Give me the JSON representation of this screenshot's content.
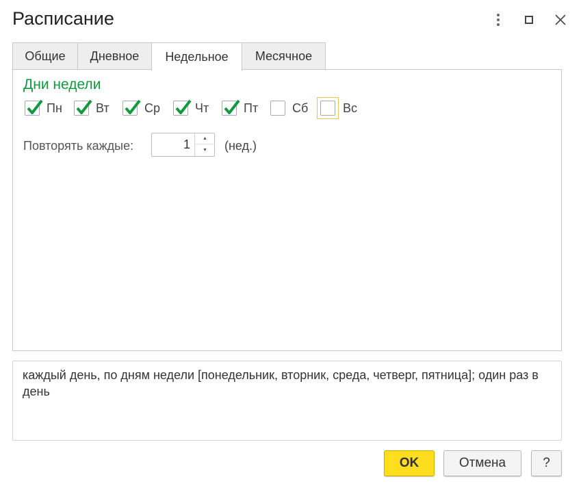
{
  "window": {
    "title": "Расписание",
    "menu_icon": "more-vertical-icon",
    "maximize_icon": "maximize-icon",
    "close_icon": "close-icon"
  },
  "tabs": [
    {
      "label": "Общие",
      "active": false
    },
    {
      "label": "Дневное",
      "active": false
    },
    {
      "label": "Недельное",
      "active": true
    },
    {
      "label": "Месячное",
      "active": false
    }
  ],
  "weekly": {
    "group_title": "Дни недели",
    "accent_color": "#0f9a3e",
    "days": [
      {
        "label": "Пн",
        "checked": true
      },
      {
        "label": "Вт",
        "checked": true
      },
      {
        "label": "Ср",
        "checked": true
      },
      {
        "label": "Чт",
        "checked": true
      },
      {
        "label": "Пт",
        "checked": true
      },
      {
        "label": "Сб",
        "checked": false
      },
      {
        "label": "Вс",
        "checked": false,
        "focused": true
      }
    ],
    "repeat_label": "Повторять каждые:",
    "repeat_value": "1",
    "repeat_unit": "(нед.)"
  },
  "summary": {
    "text": "каждый день, по дням недели [понедельник, вторник, среда, четверг, пятница]; один раз в день"
  },
  "buttons": {
    "ok": "OK",
    "cancel": "Отмена",
    "help": "?",
    "ok_color": "#ffdd1f"
  }
}
